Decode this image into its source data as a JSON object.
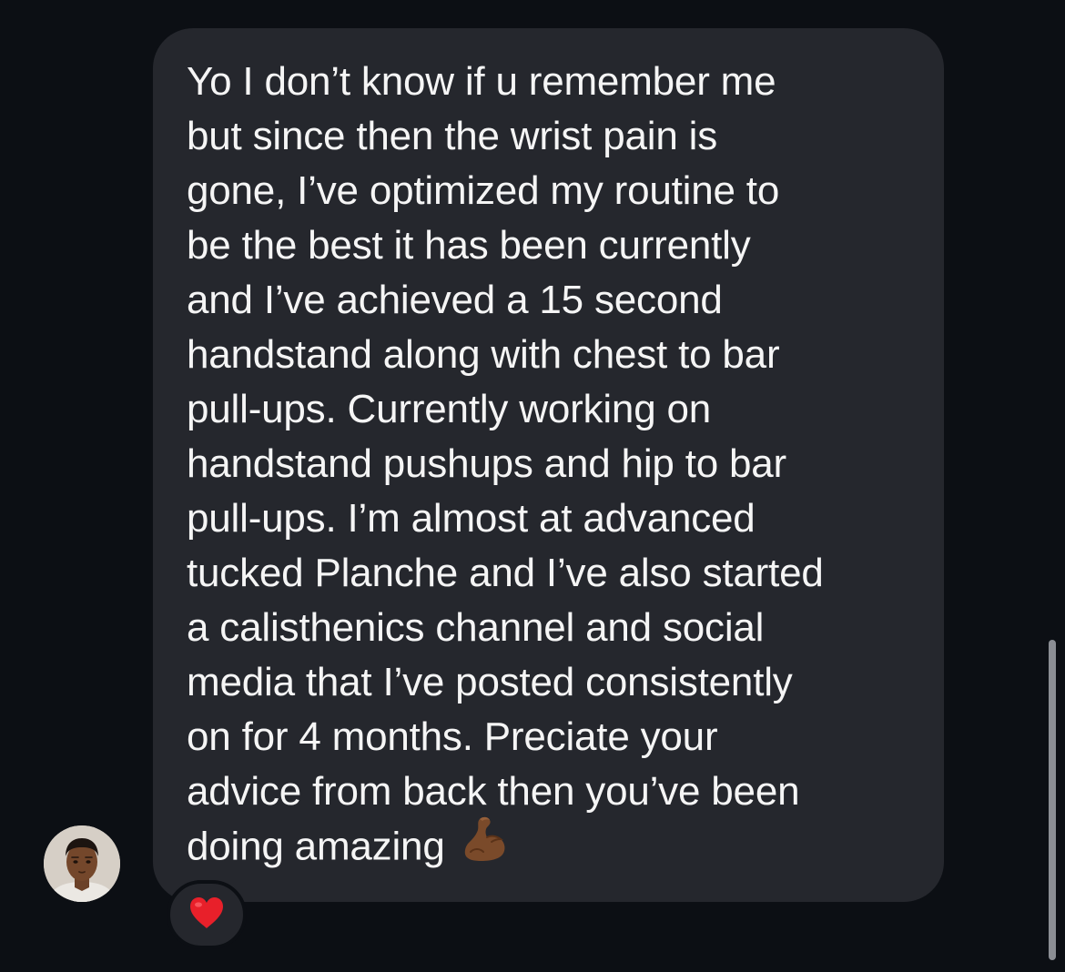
{
  "message": {
    "lines": [
      "Yo I don’t know if u remember me",
      "but since then the wrist pain is",
      "gone, I’ve optimized my routine to",
      "be the best it has been currently",
      "and I’ve achieved a 15 second",
      "handstand along with chest to bar",
      "pull-ups. Currently working on",
      "handstand pushups and hip to bar",
      "pull-ups. I’m almost at advanced",
      "tucked Planche and I’ve also started",
      "a calisthenics channel and social",
      "media that I’ve posted consistently",
      "on for 4 months. Preciate your",
      "advice from back then you’ve been",
      "doing amazing"
    ],
    "trailing_emoji": "flexed-biceps-icon"
  },
  "reaction": {
    "icon": "heart-icon",
    "color": "#e8202a"
  },
  "colors": {
    "background": "#0c0f14",
    "bubble": "#25272d",
    "text": "#f5f5f5"
  }
}
